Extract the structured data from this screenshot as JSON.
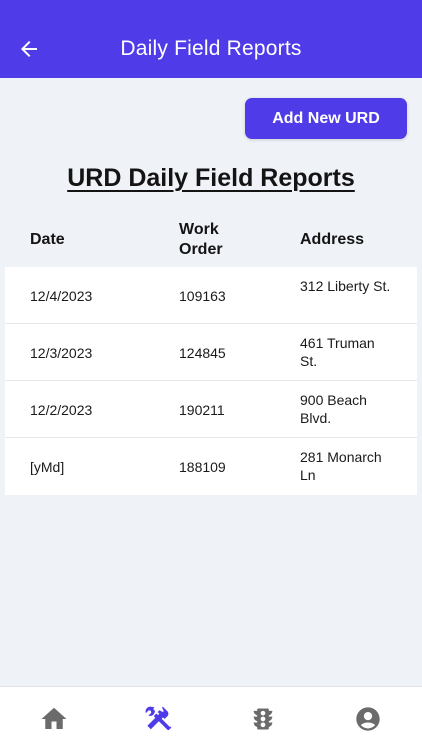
{
  "appbar": {
    "title": "Daily Field Reports",
    "back_icon": "arrow-left-icon",
    "color": "#4f3ce8"
  },
  "actions": {
    "add_label": "Add New URD"
  },
  "page": {
    "title": "URD Daily Field Reports"
  },
  "table": {
    "headers": {
      "date": "Date",
      "work_order": "Work Order",
      "address": "Address"
    },
    "rows": [
      {
        "date": "12/4/2023",
        "work_order": "109163",
        "address": "312 Liberty St."
      },
      {
        "date": "12/3/2023",
        "work_order": "124845",
        "address": "461 Truman St."
      },
      {
        "date": "12/2/2023",
        "work_order": "190211",
        "address": "900 Beach Blvd."
      },
      {
        "date": "[yMd]",
        "work_order": "188109",
        "address": "281 Monarch Ln"
      }
    ]
  },
  "bottom_nav": {
    "items": [
      {
        "icon": "home-icon",
        "active": false
      },
      {
        "icon": "tools-icon",
        "active": true
      },
      {
        "icon": "traffic-light-icon",
        "active": false
      },
      {
        "icon": "account-icon",
        "active": false
      }
    ],
    "active_color": "#4f3ce8",
    "inactive_color": "#6b6b6b"
  }
}
